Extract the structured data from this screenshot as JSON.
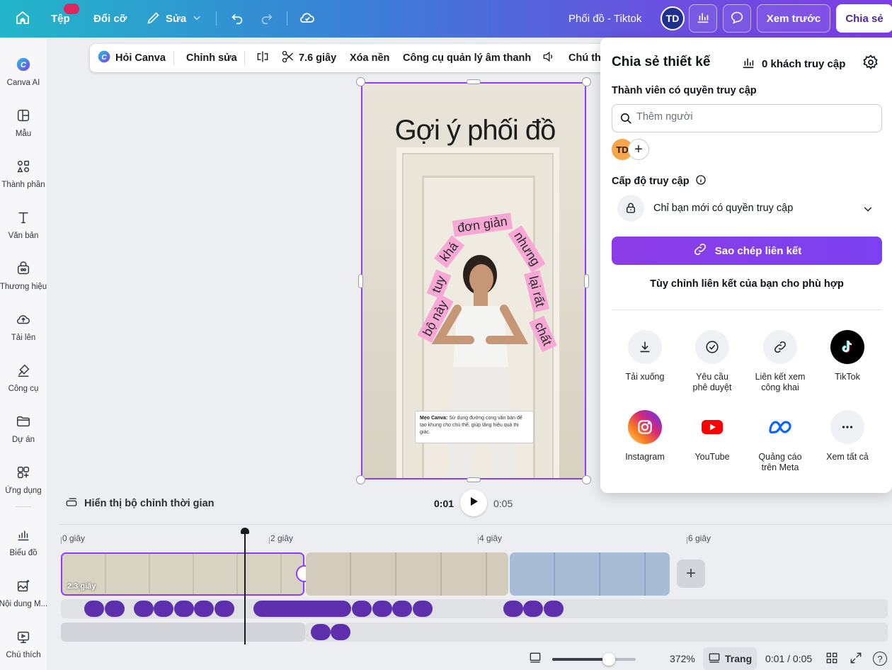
{
  "topbar": {
    "file_label": "Tệp",
    "resize_label": "Đổi cỡ",
    "edit_label": "Sửa",
    "design_title": "Phối đồ - Tiktok",
    "avatar_initials": "TD",
    "preview_label": "Xem trước",
    "share_label": "Chia sẻ",
    "icons": [
      "home-icon",
      "pencil-icon",
      "chevron-down-icon",
      "undo-icon",
      "redo-icon",
      "cloud-check-icon",
      "analytics-icon",
      "comment-icon"
    ]
  },
  "sidebar": {
    "items": [
      {
        "label": "Canva AI",
        "icon": "canva-ai-icon"
      },
      {
        "label": "Mẫu",
        "icon": "template-icon"
      },
      {
        "label": "Thành phần",
        "icon": "elements-icon"
      },
      {
        "label": "Văn bản",
        "icon": "text-icon"
      },
      {
        "label": "Thương hiệu",
        "icon": "brand-icon"
      },
      {
        "label": "Tải lên",
        "icon": "upload-icon"
      },
      {
        "label": "Công cụ",
        "icon": "tools-icon"
      },
      {
        "label": "Dự án",
        "icon": "folder-icon"
      },
      {
        "label": "Ứng dụng",
        "icon": "apps-icon"
      },
      {
        "label": "Biểu đồ",
        "icon": "chart-icon"
      },
      {
        "label": "Nội dung M...",
        "icon": "magic-media-icon"
      },
      {
        "label": "Chú thích",
        "icon": "caption-icon"
      }
    ]
  },
  "context_toolbar": {
    "ask_canva": "Hỏi Canva",
    "edit": "Chỉnh sửa",
    "duration": "7.6 giây",
    "remove_bg": "Xóa nền",
    "audio_tools": "Công cụ quản lý âm thanh",
    "captions": "Chú th"
  },
  "canvas": {
    "title": "Gợi ý phối đồ",
    "curved_words": [
      "bộ này",
      "tuy",
      "khá",
      "đơn giản",
      "nhưng",
      "lại rất",
      "chất"
    ],
    "tip_bold": "Mẹo Canva:",
    "tip_text": "Sử dụng đường cong văn bản để tạo khung cho chủ thể, giúp tăng hiệu quả thị giác."
  },
  "playback": {
    "toggle_label": "Hiển thị bộ chỉnh thời gian",
    "current_time": "0:01",
    "total_time": "0:05"
  },
  "timeline": {
    "ticks": [
      "0 giây",
      "2 giây",
      "4 giây",
      "6 giây"
    ],
    "selected_clip_label": "2.3 giây"
  },
  "bottom_bar": {
    "zoom": "372%",
    "zoom_level": 0.68,
    "pages_label": "Trang",
    "time": "0:01 / 0:05",
    "help": "?"
  },
  "share_panel": {
    "title": "Chia sẻ thiết kế",
    "visitors": "0 khách truy cập",
    "members_label": "Thành viên có quyền truy cập",
    "search_placeholder": "Thêm người",
    "member_initials": "TD",
    "access_level_label": "Cấp độ truy cập",
    "access_value": "Chỉ bạn mới có quyền truy cập",
    "copy_link": "Sao chép liên kết",
    "customize_link": "Tùy chỉnh liên kết của bạn cho phù hợp",
    "options": [
      {
        "label": "Tải xuống",
        "icon": "download-icon"
      },
      {
        "label": "Yêu cầu phê duyệt",
        "icon": "approval-icon"
      },
      {
        "label": "Liên kết xem công khai",
        "icon": "link-icon"
      },
      {
        "label": "TikTok",
        "icon": "tiktok-icon"
      },
      {
        "label": "Instagram",
        "icon": "instagram-icon"
      },
      {
        "label": "YouTube",
        "icon": "youtube-icon"
      },
      {
        "label": "Quảng cáo trên Meta",
        "icon": "meta-icon"
      },
      {
        "label": "Xem tất cả",
        "icon": "more-icon"
      }
    ],
    "accent_color": "#8b3dff"
  }
}
